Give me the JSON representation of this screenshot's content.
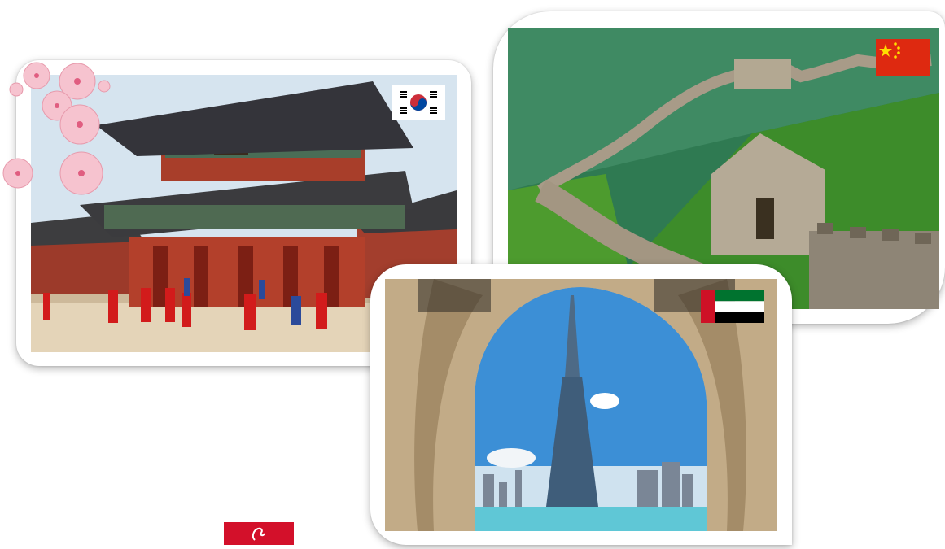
{
  "header": {
    "title": ""
  },
  "cards": [
    {
      "id": "korea",
      "flag": "south-korea-flag",
      "subject": "palace-gate-photo"
    },
    {
      "id": "china",
      "flag": "china-flag",
      "subject": "great-wall-photo"
    },
    {
      "id": "uae",
      "flag": "uae-flag",
      "subject": "skyscraper-arch-photo"
    }
  ],
  "decorations": [
    "cherry-blossom-icon"
  ],
  "logo": {
    "icon": "brand-logo-icon",
    "color": "#d3102a"
  },
  "colors": {
    "accent": "#e02020",
    "sky": "#cfe0ee",
    "red": "#c8101e",
    "green": "#2f7a34"
  }
}
